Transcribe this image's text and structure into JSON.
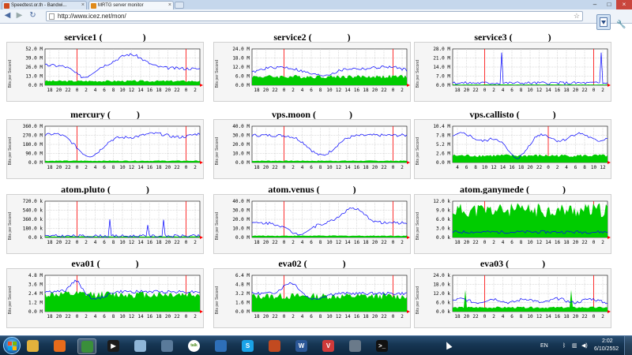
{
  "browser": {
    "tabs": [
      {
        "title": "Speedtest.or.th - Bandwi...",
        "favicon_color": "#d04a1d"
      },
      {
        "title": "MRTG server monitor",
        "favicon_color": "#e08a1a"
      }
    ],
    "url": "http://www.icez.net/mon/",
    "back_icon": "back-arrow-icon",
    "forward_icon": "forward-arrow-icon",
    "reload_icon": "reload-icon",
    "bookmark_icon": "star-icon",
    "menu_icon": "wrench-icon"
  },
  "colors": {
    "inbound": "#00cc00",
    "outbound": "#0000ff",
    "max_peak": "#006600",
    "grid": "#bbbbbb",
    "day_marker": "#ff0000",
    "plot_bg": "#ffffff"
  },
  "y_axis_label": "Bits per Second",
  "graphs": [
    {
      "title": "service1 (                 )",
      "yticks": [
        "52.0 M",
        "39.0 M",
        "26.0 M",
        "13.0 M",
        "0.0 M"
      ],
      "xticks": [
        "18",
        "20",
        "22",
        "0",
        "2",
        "4",
        "6",
        "8",
        "10",
        "12",
        "14",
        "16",
        "18",
        "20",
        "22",
        "0",
        "2"
      ]
    },
    {
      "title": "service2 (               )",
      "yticks": [
        "24.0 M",
        "18.0 M",
        "12.0 M",
        "6.0 M",
        "0.0 M"
      ],
      "xticks": [
        "18",
        "20",
        "22",
        "0",
        "2",
        "4",
        "6",
        "8",
        "10",
        "12",
        "14",
        "16",
        "18",
        "20",
        "22",
        "0",
        "2"
      ]
    },
    {
      "title": "service3 (               )",
      "yticks": [
        "28.0 M",
        "21.0 M",
        "14.0 M",
        "7.0 M",
        "0.0 M"
      ],
      "xticks": [
        "18",
        "20",
        "22",
        "0",
        "2",
        "4",
        "6",
        "8",
        "10",
        "12",
        "14",
        "16",
        "18",
        "20",
        "22",
        "0",
        "2"
      ]
    },
    {
      "title": "mercury (           )",
      "yticks": [
        "360.0 M",
        "270.0 M",
        "180.0 M",
        "90.0 M",
        "0.0 M"
      ],
      "xticks": [
        "18",
        "20",
        "22",
        "0",
        "2",
        "4",
        "6",
        "8",
        "10",
        "12",
        "14",
        "16",
        "18",
        "20",
        "22",
        "0",
        "2"
      ]
    },
    {
      "title": "vps.moon (              )",
      "yticks": [
        "40.0 M",
        "30.0 M",
        "20.0 M",
        "10.0 M",
        "0.0 M"
      ],
      "xticks": [
        "18",
        "20",
        "22",
        "0",
        "2",
        "4",
        "6",
        "8",
        "10",
        "12",
        "14",
        "16",
        "18",
        "20",
        "22",
        "0",
        "2"
      ]
    },
    {
      "title": "vps.callisto (              )",
      "yticks": [
        "10.4 M",
        "7.8 M",
        "5.2 M",
        "2.6 M",
        "0.0 M"
      ],
      "xticks": [
        "4",
        "6",
        "8",
        "10",
        "12",
        "14",
        "16",
        "18",
        "20",
        "22",
        "0",
        "2",
        "4",
        "6",
        "8",
        "10",
        "12"
      ]
    },
    {
      "title": "atom.pluto (               )",
      "yticks": [
        "720.0 k",
        "540.0 k",
        "360.0 k",
        "180.0 k",
        "0.0 k"
      ],
      "xticks": [
        "18",
        "20",
        "22",
        "0",
        "2",
        "4",
        "6",
        "8",
        "10",
        "12",
        "14",
        "16",
        "18",
        "20",
        "22",
        "0",
        "2"
      ]
    },
    {
      "title": "atom.venus (              )",
      "yticks": [
        "40.0 M",
        "30.0 M",
        "20.0 M",
        "10.0 M",
        "0.0 M"
      ],
      "xticks": [
        "18",
        "20",
        "22",
        "0",
        "2",
        "4",
        "6",
        "8",
        "10",
        "12",
        "14",
        "16",
        "18",
        "20",
        "22",
        "0",
        "2"
      ]
    },
    {
      "title": "atom.ganymede (              )",
      "yticks": [
        "12.0 k",
        "9.0 k",
        "6.0 k",
        "3.0 k",
        "0.0 k"
      ],
      "xticks": [
        "18",
        "20",
        "22",
        "0",
        "2",
        "4",
        "6",
        "8",
        "10",
        "12",
        "14",
        "16",
        "18",
        "20",
        "22",
        "0",
        "2"
      ]
    },
    {
      "title": "eva01 (               )",
      "yticks": [
        "4.8 M",
        "3.6 M",
        "2.4 M",
        "1.2 M",
        "0.0 M"
      ],
      "xticks": [
        "18",
        "20",
        "22",
        "0",
        "2",
        "4",
        "6",
        "8",
        "10",
        "12",
        "14",
        "16",
        "18",
        "20",
        "22",
        "0",
        "2"
      ]
    },
    {
      "title": "eva02 (               )",
      "yticks": [
        "6.4 M",
        "4.8 M",
        "3.2 M",
        "1.6 M",
        "0.0 M"
      ],
      "xticks": [
        "18",
        "20",
        "22",
        "0",
        "2",
        "4",
        "6",
        "8",
        "10",
        "12",
        "14",
        "16",
        "18",
        "20",
        "22",
        "0",
        "2"
      ]
    },
    {
      "title": "eva03 (              )",
      "yticks": [
        "24.0 k",
        "18.0 k",
        "12.0 k",
        "6.0 k",
        "0.0 k"
      ],
      "xticks": [
        "18",
        "20",
        "22",
        "0",
        "2",
        "4",
        "6",
        "8",
        "10",
        "12",
        "14",
        "16",
        "18",
        "20",
        "22",
        "0",
        "2"
      ]
    }
  ],
  "taskbar": {
    "apps": [
      {
        "name": "explorer-icon",
        "color": "#e3b23c",
        "glyph": ""
      },
      {
        "name": "firefox-icon",
        "color": "#e86b1a",
        "glyph": ""
      },
      {
        "name": "chrome-icon",
        "color": "#3a8f3a",
        "glyph": ""
      },
      {
        "name": "media-player-icon",
        "color": "#1b1b1b",
        "glyph": "▶"
      },
      {
        "name": "notepad-icon",
        "color": "#8fb6d8",
        "glyph": ""
      },
      {
        "name": "network-icon",
        "color": "#5a7a9a",
        "glyph": ""
      },
      {
        "name": "gtalk-icon",
        "color": "#9ccc4a",
        "glyph": "talk"
      },
      {
        "name": "globe-icon",
        "color": "#2e6fb8",
        "glyph": ""
      },
      {
        "name": "skype-icon",
        "color": "#1aa3e8",
        "glyph": "S"
      },
      {
        "name": "folder-icon",
        "color": "#c24a20",
        "glyph": ""
      },
      {
        "name": "word-icon",
        "color": "#2b5797",
        "glyph": "W"
      },
      {
        "name": "visio-icon",
        "color": "#d03a3a",
        "glyph": "V"
      },
      {
        "name": "tool-icon",
        "color": "#6a7a8a",
        "glyph": ""
      },
      {
        "name": "cmd-icon",
        "color": "#111111",
        "glyph": ">_"
      }
    ],
    "language": "EN",
    "time": "2:02",
    "date": "6/10/2552"
  }
}
